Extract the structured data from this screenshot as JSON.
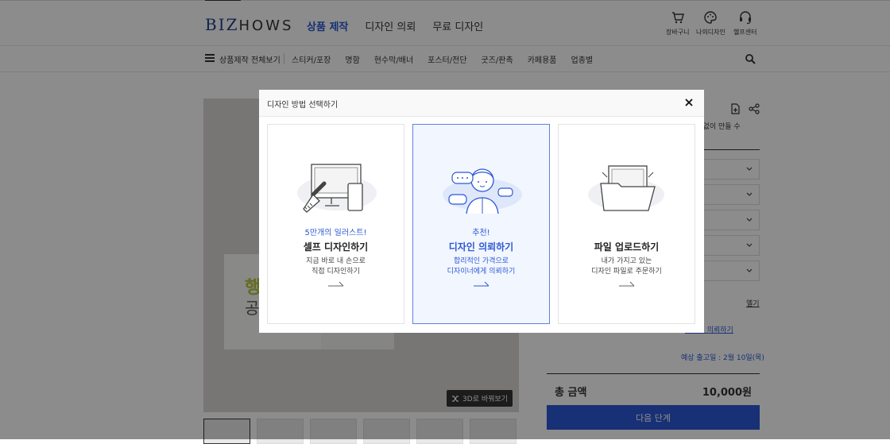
{
  "header": {
    "logo_main": "BIZ",
    "logo_rest": "HOWS",
    "nav": [
      "상품 제작",
      "디자인 의뢰",
      "무료 디자인"
    ],
    "util": {
      "cart": "장바구니",
      "my_design": "나의디자인",
      "help": "헬프센터"
    }
  },
  "subnav": {
    "all": "상품제작 전체보기",
    "categories": [
      "스티커/포장",
      "명함",
      "현수막/배너",
      "포스터/전단",
      "굿즈/판촉",
      "카페용품",
      "업종별"
    ]
  },
  "product": {
    "btn_3d": "3D로 바꿔보기",
    "card_headline": "행",
    "card_headline2": "공"
  },
  "right": {
    "desc": "부담없이 만들 수",
    "link1": "옐기",
    "link2": "디자인 의뢰하기",
    "ship": "예상 출고일 : 2월 10일(목)",
    "total_label": "총 금액",
    "total_value": "10,000원",
    "next_label": "다음 단계"
  },
  "modal": {
    "title": "디자인 방법 선택하기",
    "options": [
      {
        "tag": "5만개의 일러스트!",
        "title": "셀프 디자인하기",
        "line1": "지금 바로 내 손으로",
        "line2": "직접 디자인하기"
      },
      {
        "tag": "추천!",
        "title": "디자인 의뢰하기",
        "line1": "합리적인 가격으로",
        "line2": "디자이너에게 의뢰하기"
      },
      {
        "tag": "",
        "title": "파일 업로드하기",
        "line1": "내가 가지고 있는",
        "line2": "디자인 파일로 주문하기"
      }
    ]
  },
  "colors": {
    "accent": "#2c58d6",
    "overlay": "rgba(0,0,0,0.45)"
  }
}
